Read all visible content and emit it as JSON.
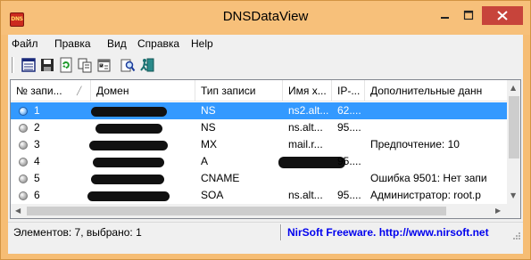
{
  "window": {
    "title": "DNSDataView",
    "icon_text": "DNS"
  },
  "menu": [
    "Файл",
    "Правка",
    "Вид",
    "Справка",
    "Help"
  ],
  "toolbar": {
    "icons": [
      "properties-icon",
      "save-icon",
      "refresh-icon",
      "copy-icon",
      "options-icon",
      "find-icon",
      "exit-icon"
    ]
  },
  "columns": [
    "№ запи...",
    "Домен",
    "Тип записи",
    "Имя х...",
    "IP-...",
    "Дополнительные данн"
  ],
  "rows": [
    {
      "num": "1",
      "type": "NS",
      "host": "ns2.alt...",
      "ip": "62....",
      "extra": "",
      "selected": true
    },
    {
      "num": "2",
      "type": "NS",
      "host": "ns.alt...",
      "ip": "95....",
      "extra": "",
      "selected": false
    },
    {
      "num": "3",
      "type": "MX",
      "host": "mail.r...",
      "ip": "",
      "extra": "Предпочтение: 10",
      "selected": false
    },
    {
      "num": "4",
      "type": "A",
      "host": "",
      "ip": "95....",
      "extra": "",
      "selected": false
    },
    {
      "num": "5",
      "type": "CNAME",
      "host": "",
      "ip": "",
      "extra": "Ошибка 9501: Нет запи",
      "selected": false
    },
    {
      "num": "6",
      "type": "SOA",
      "host": "ns.alt...",
      "ip": "95....",
      "extra": "Администратор: root.p",
      "selected": false
    }
  ],
  "status": {
    "left": "Элементов: 7, выбрано: 1",
    "right": "NirSoft Freeware.  http://www.nirsoft.net"
  },
  "colors": {
    "titlebar": "#f7c07a",
    "selection": "#3399ff",
    "close_button": "#c7443b",
    "link": "#0000ee"
  }
}
